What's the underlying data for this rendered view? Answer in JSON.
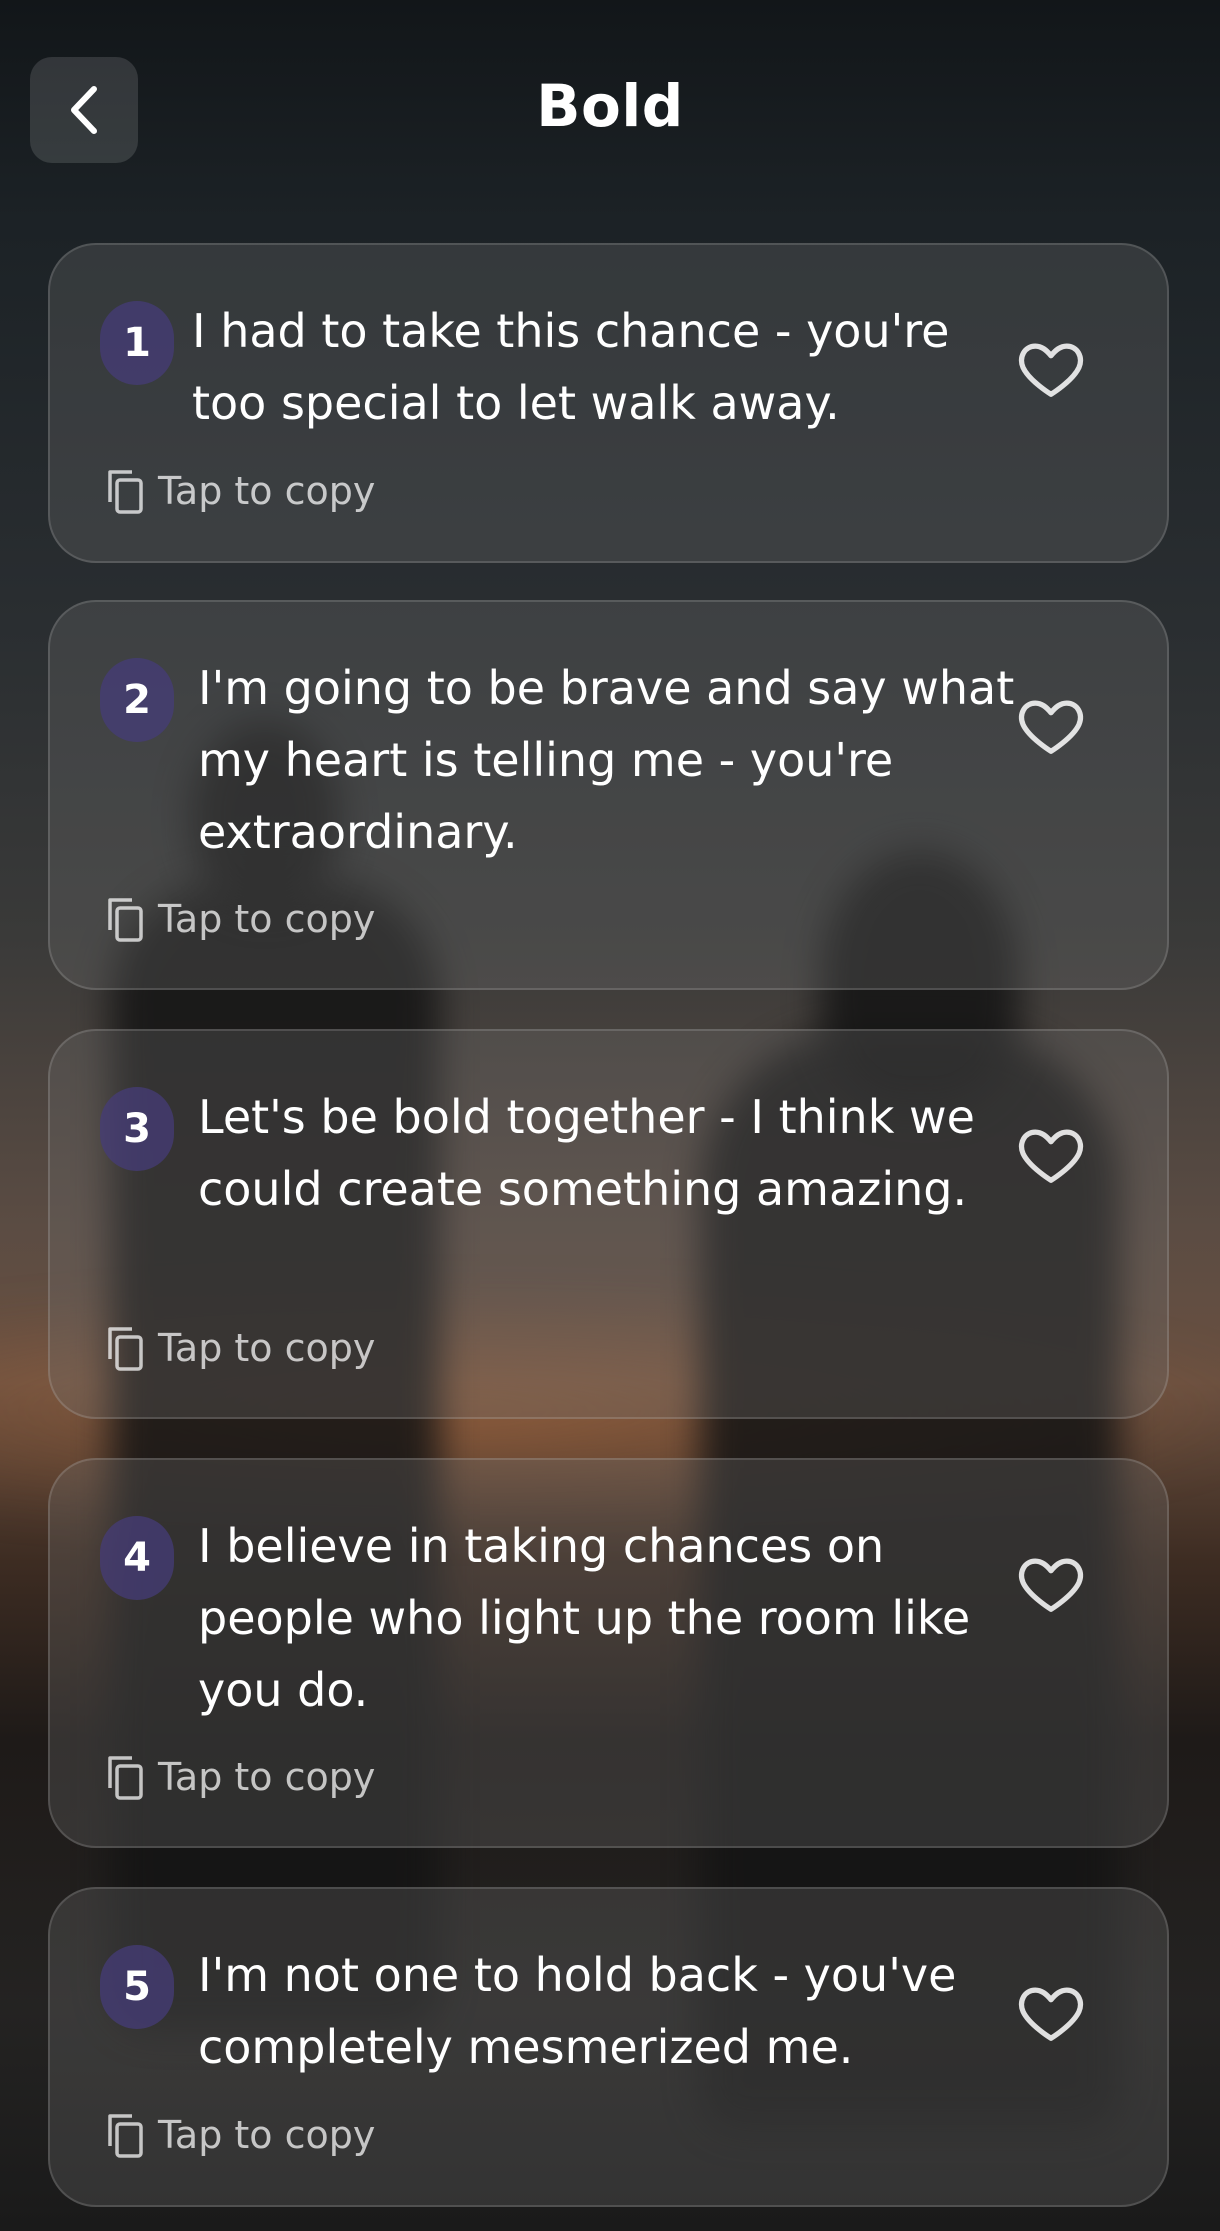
{
  "header": {
    "title": "Bold"
  },
  "cards": [
    {
      "number": "1",
      "text": "I had to take this chance - you're too special to let walk away.",
      "copy_label": "Tap to copy"
    },
    {
      "number": "2",
      "text": "I'm going to be brave and say what my heart is telling me - you're extraordinary.",
      "copy_label": "Tap to copy"
    },
    {
      "number": "3",
      "text": "Let's be bold together - I think we could create something amazing.",
      "copy_label": "Tap to copy"
    },
    {
      "number": "4",
      "text": "I believe in taking chances on people who light up the room like you do.",
      "copy_label": "Tap to copy"
    },
    {
      "number": "5",
      "text": "I'm not one to hold back - you've completely mesmerized me.",
      "copy_label": "Tap to copy"
    }
  ],
  "icons": {
    "back": "chevron-left-icon",
    "favorite": "heart-outline-icon",
    "copy": "copy-icon"
  }
}
